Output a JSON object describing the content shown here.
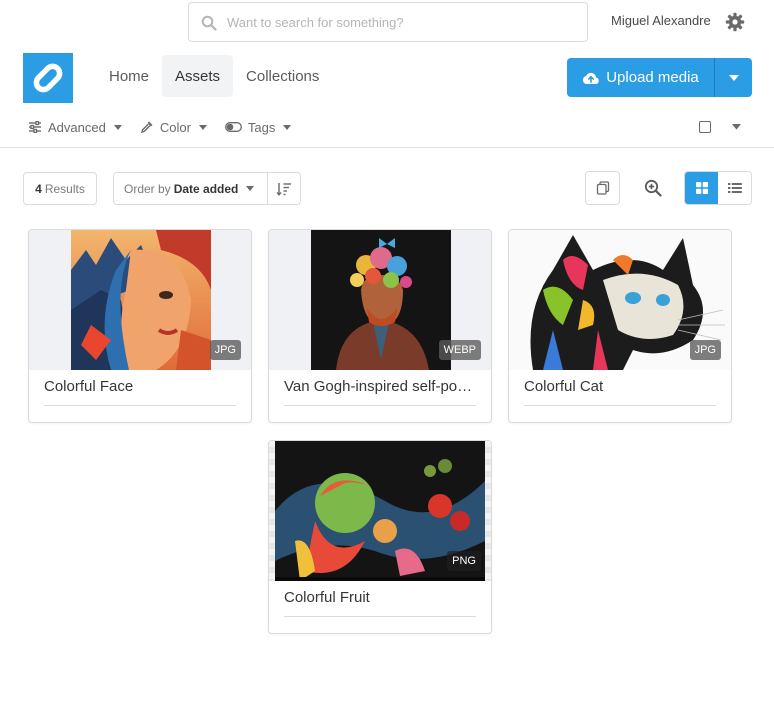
{
  "search": {
    "placeholder": "Want to search for something?"
  },
  "user": {
    "name": "Miguel Alexandre"
  },
  "nav": {
    "items": [
      {
        "label": "Home"
      },
      {
        "label": "Assets"
      },
      {
        "label": "Collections"
      }
    ],
    "active": "Assets"
  },
  "upload": {
    "label": "Upload media"
  },
  "filters": {
    "advanced": "Advanced",
    "color": "Color",
    "tags": "Tags"
  },
  "results": {
    "count": "4",
    "label": "Results"
  },
  "order": {
    "prefix": "Order by",
    "value": "Date added"
  },
  "assets": [
    {
      "title": "Colorful Face",
      "format": "JPG"
    },
    {
      "title": "Van Gogh-inspired self-portrait",
      "format": "WEBP"
    },
    {
      "title": "Colorful Cat",
      "format": "JPG"
    },
    {
      "title": "Colorful Fruit",
      "format": "PNG"
    }
  ],
  "colors": {
    "accent": "#2b9de5",
    "border": "#dbdbdb",
    "text": "#363636"
  },
  "icons": [
    "search-icon",
    "gear-icon",
    "logo-icon",
    "upload-cloud-icon",
    "chevron-down-icon",
    "sliders-icon",
    "eyedropper-icon",
    "toggle-icon",
    "checkbox-icon",
    "sort-icon",
    "copy-icon",
    "zoom-icon",
    "grid-view-icon",
    "list-view-icon"
  ]
}
